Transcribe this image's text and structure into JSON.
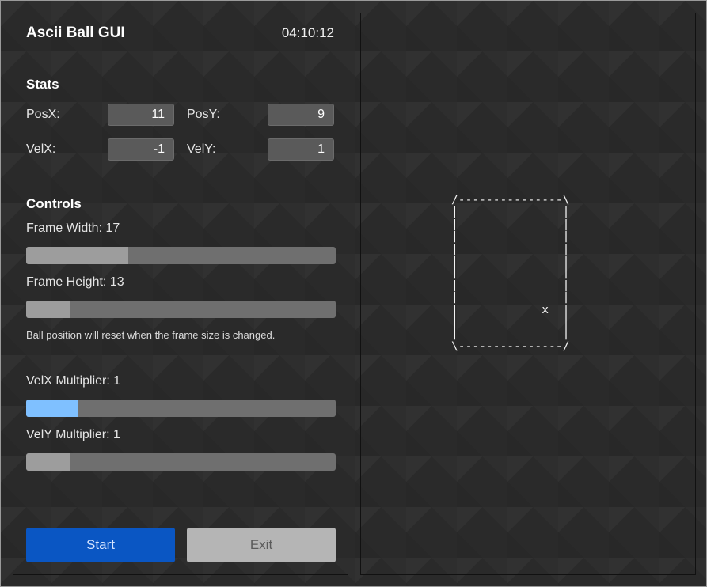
{
  "app": {
    "title": "Ascii Ball GUI",
    "clock": "04:10:12"
  },
  "stats": {
    "title": "Stats",
    "posx": {
      "label": "PosX:",
      "value": "11"
    },
    "posy": {
      "label": "PosY:",
      "value": "9"
    },
    "velx": {
      "label": "VelX:",
      "value": "-1"
    },
    "vely": {
      "label": "VelY:",
      "value": "1"
    }
  },
  "controls": {
    "title": "Controls",
    "frame_width": {
      "label": "Frame Width: 17",
      "fraction": 0.33
    },
    "frame_height": {
      "label": "Frame Height: 13",
      "fraction": 0.14
    },
    "note": "Ball position will reset when the frame size is changed.",
    "velx_multiplier": {
      "label": "VelX Multiplier: 1",
      "fraction": 0.165,
      "color": "#7fc0ff"
    },
    "vely_multiplier": {
      "label": "VelY Multiplier: 1",
      "fraction": 0.14
    }
  },
  "buttons": {
    "start": "Start",
    "exit": "Exit"
  },
  "frame": {
    "ascii": "/---------------\\\n|               |\n|               |\n|               |\n|               |\n|               |\n|               |\n|               |\n|               |\n|            x  |\n|               |\n|               |\n\\---------------/"
  },
  "colors": {
    "accent_button": "#0a56c3",
    "accent_slider": "#7fc0ff",
    "background": "#2a2a2a"
  }
}
